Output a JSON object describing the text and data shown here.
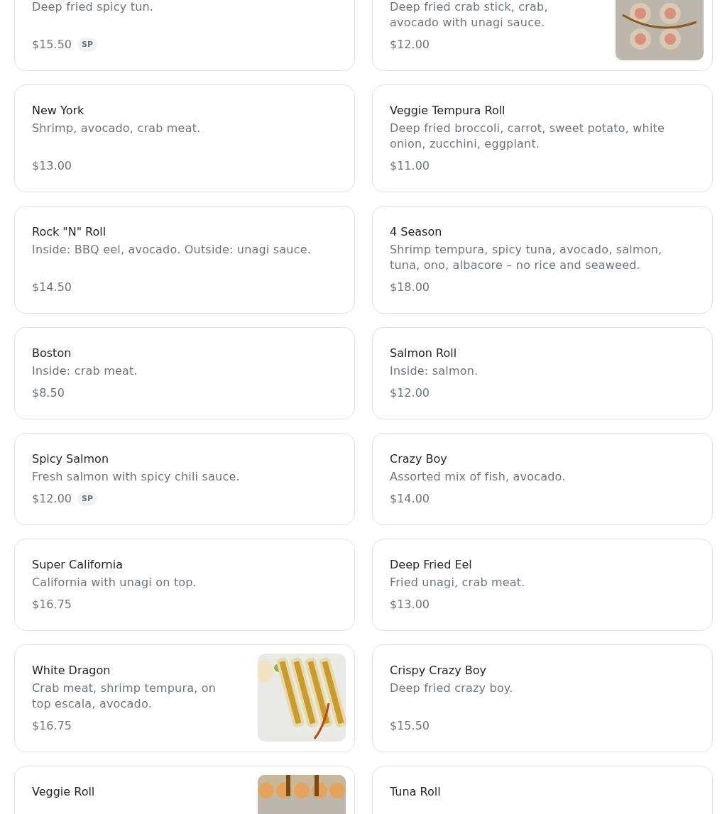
{
  "menu_items": [
    {
      "description": "Deep fried spicy tun.",
      "price": "$15.50",
      "badge": "SP"
    },
    {
      "description": "Deep fried crab stick, crab, avocado with unagi sauce.",
      "price": "$12.00"
    },
    {
      "title": "New York",
      "description": "Shrimp, avocado, crab meat.",
      "price": "$13.00"
    },
    {
      "title": "Veggie Tempura Roll",
      "description": "Deep fried broccoli, carrot, sweet potato, white onion, zucchini, eggplant.",
      "price": "$11.00"
    },
    {
      "title": "Rock \"N\" Roll",
      "description": "Inside: BBQ eel, avocado. Outside: unagi sauce.",
      "price": "$14.50"
    },
    {
      "title": "4 Season",
      "description": "Shrimp tempura, spicy tuna, avocado, salmon, tuna, ono, albacore – no rice and seaweed.",
      "price": "$18.00"
    },
    {
      "title": "Boston",
      "description": "Inside: crab meat.",
      "price": "$8.50"
    },
    {
      "title": "Salmon Roll",
      "description": "Inside: salmon.",
      "price": "$12.00"
    },
    {
      "title": "Spicy Salmon",
      "description": "Fresh salmon with spicy chili sauce.",
      "price": "$12.00",
      "badge": "SP"
    },
    {
      "title": "Crazy Boy",
      "description": "Assorted mix of fish, avocado.",
      "price": "$14.00"
    },
    {
      "title": "Super California",
      "description": "California with unagi on top.",
      "price": "$16.75"
    },
    {
      "title": "Deep Fried Eel",
      "description": "Fried unagi, crab meat.",
      "price": "$13.00"
    },
    {
      "title": "White Dragon",
      "description": "Crab meat, shrimp tempura, on top escala, avocado.",
      "price": "$16.75"
    },
    {
      "title": "Crispy Crazy Boy",
      "description": "Deep fried crazy boy.",
      "price": "$15.50"
    },
    {
      "title": "Veggie Roll"
    },
    {
      "title": "Tuna Roll"
    }
  ]
}
